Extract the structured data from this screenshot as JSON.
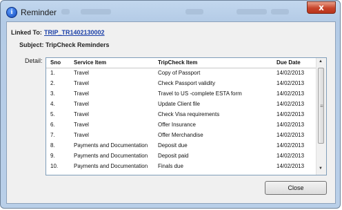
{
  "window": {
    "title": "Reminder",
    "close_glyph": "x",
    "icon": "info-icon"
  },
  "linked_to": {
    "label": "Linked To:",
    "value": "TRIP_TR1402130002"
  },
  "subject": {
    "label": "Subject:",
    "value": "TripCheck Reminders"
  },
  "detail_label": "Detail:",
  "table": {
    "columns": [
      "Sno",
      "Service Item",
      "TripCheck Item",
      "Due Date"
    ],
    "rows": [
      [
        "1.",
        "Travel",
        "Copy of Passport",
        "14/02/2013"
      ],
      [
        "2.",
        "Travel",
        "Check Passport validity",
        "14/02/2013"
      ],
      [
        "3.",
        "Travel",
        "Travel to US -complete ESTA form",
        "14/02/2013"
      ],
      [
        "4.",
        "Travel",
        "Update Client file",
        "14/02/2013"
      ],
      [
        "5.",
        "Travel",
        "Check Visa requirements",
        "14/02/2013"
      ],
      [
        "6.",
        "Travel",
        "Offer Insurance",
        "14/02/2013"
      ],
      [
        "7.",
        "Travel",
        "Offer Merchandise",
        "14/02/2013"
      ],
      [
        "8.",
        "Payments and Documentation",
        "Deposit due",
        "14/02/2013"
      ],
      [
        "9.",
        "Payments and Documentation",
        "Deposit paid",
        "14/02/2013"
      ],
      [
        "10.",
        "Payments and Documentation",
        "Finals due",
        "14/02/2013"
      ]
    ]
  },
  "scrollbar": {
    "up": "▲",
    "down": "▼",
    "grip": "≡"
  },
  "buttons": {
    "close": "Close"
  }
}
